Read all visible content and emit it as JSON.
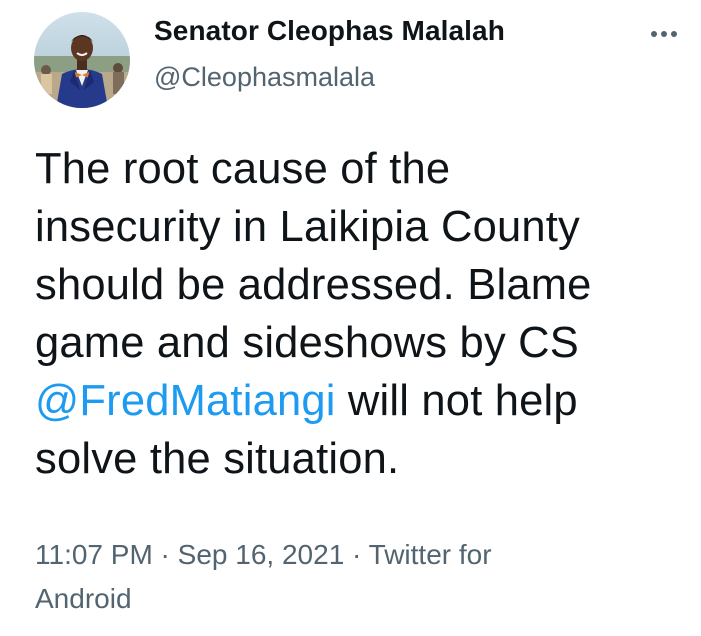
{
  "tweet": {
    "author": {
      "name": "Senator Cleophas Malalah",
      "handle": "@Cleophasmalala"
    },
    "more_icon": "more-horizontal-icon",
    "text": {
      "line1": "The root cause of the",
      "line2": "insecurity in Laikipia County",
      "line3": "should be addressed. Blame",
      "line4": "game and sideshows by CS",
      "mention": "@FredMatiangi",
      "line5_rest": " will not help",
      "line6": "solve the situation."
    },
    "meta": {
      "time": "11:07 PM",
      "sep1": " · ",
      "date": "Sep 16, 2021",
      "sep2": " · ",
      "source_part1": "Twitter for",
      "source_part2": "Android"
    },
    "colors": {
      "text": "#0f1419",
      "secondary": "#536471",
      "link": "#1d9bf0"
    }
  }
}
